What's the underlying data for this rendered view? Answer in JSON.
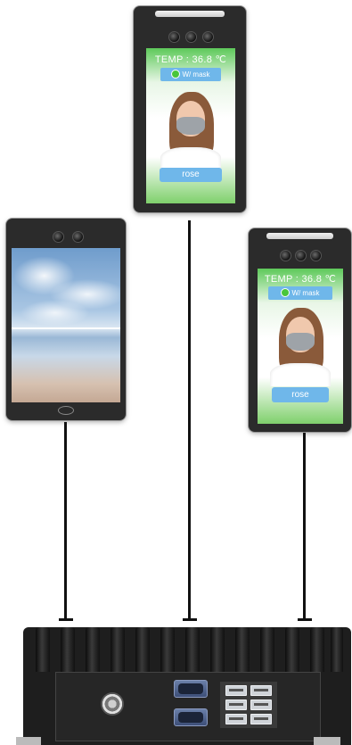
{
  "kiosks": {
    "top": {
      "temp": "TEMP : 36.8 ℃",
      "mask": "W/ mask",
      "name": "rose"
    },
    "right": {
      "temp": "TEMP : 36.8 ℃",
      "mask": "W/ mask",
      "name": "rose"
    }
  },
  "colors": {
    "wire": "#111111",
    "pill": "#6fb7ea",
    "screen_green": "#5ec95a",
    "device_body": "#2b2b2b"
  },
  "icons": [
    "camera-icon",
    "ir-sensor-icon",
    "check-dot-icon",
    "power-button-icon",
    "com-port-icon",
    "usb-port-icon"
  ]
}
